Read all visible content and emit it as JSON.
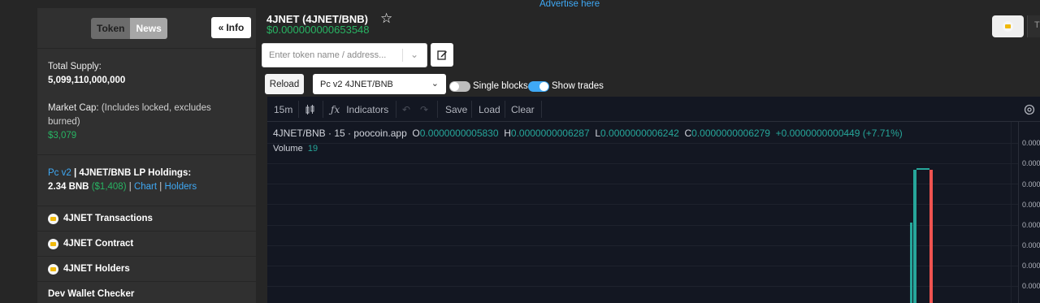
{
  "header": {
    "advertise": "Advertise here",
    "title": "4JNET (4JNET/BNB)",
    "price": "$0.000000000653548"
  },
  "sidebar": {
    "tabs": [
      "Token",
      "News"
    ],
    "info_button": "Info",
    "total_supply_label": "Total Supply:",
    "total_supply_value": "5,099,110,000,000",
    "market_cap_label": "Market Cap:",
    "market_cap_note": "(Includes locked, excludes burned)",
    "market_cap_value": "$3,079",
    "lp_version": "Pc v2",
    "lp_label": "| 4JNET/BNB LP Holdings:",
    "lp_amount": "2.34 BNB",
    "lp_usd": "($1,408)",
    "lp_chart": "Chart",
    "lp_holders": "Holders",
    "rows": [
      "4JNET Transactions",
      "4JNET Contract",
      "4JNET Holders",
      "Dev Wallet Checker"
    ]
  },
  "controls": {
    "search_placeholder": "Enter token name / address...",
    "reload": "Reload",
    "pair_selected": "Pc v2 4JNET/BNB",
    "single_blocks": "Single blocks",
    "show_trades": "Show trades",
    "single_blocks_on": false,
    "show_trades_on": true
  },
  "chart": {
    "toolbar": {
      "interval": "15m",
      "indicators": "Indicators",
      "save": "Save",
      "load": "Load",
      "clear": "Clear"
    },
    "legend": {
      "symbol": "4JNET/BNB · 15 · poocoin.app",
      "o_label": "O",
      "o_value": "0.0000000005830",
      "h_label": "H",
      "h_value": "0.0000000006287",
      "l_label": "L",
      "l_value": "0.0000000006242",
      "c_label": "C",
      "c_value": "0.0000000006279",
      "change": "+0.0000000000449 (+7.71%)"
    },
    "volume_label": "Volume",
    "volume_value": "19",
    "price_axis_label": "0.000"
  },
  "colors": {
    "up": "#26a69a",
    "down": "#ef5350",
    "accent": "#3fa9f5",
    "price_green": "#28b463"
  }
}
